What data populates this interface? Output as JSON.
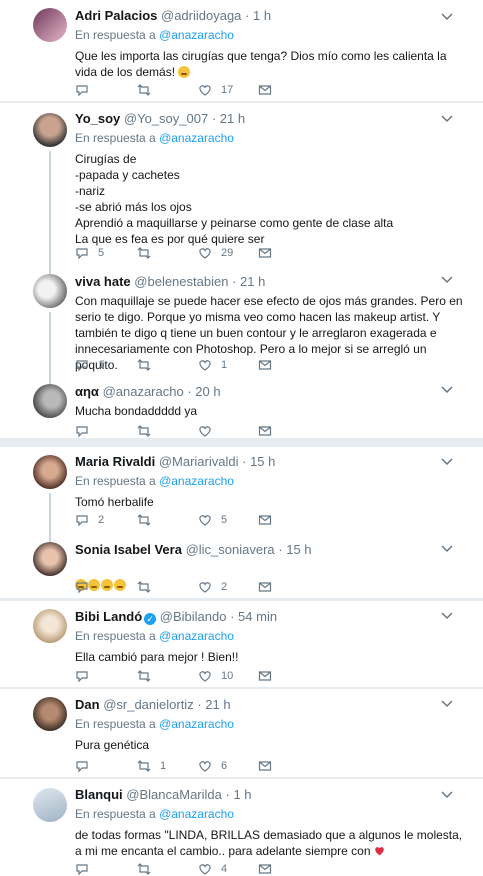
{
  "colors": {
    "accent": "#1da1f2",
    "heart": "#e0245e",
    "muted": "#657786",
    "background": "#e6ecf0"
  },
  "tweets": [
    {
      "name": "Adri Palacios",
      "handle": "@adriidoyaga",
      "time": "· 1 h",
      "reply_prefix": "En respuesta a",
      "reply_to": "@anazaracho",
      "text": "Que les importa las cirugías que tenga? Dios mío como les calienta la vida de los demás!",
      "emoji": "grinning-face-emoji",
      "replies": "",
      "retweets": "",
      "likes": "17"
    },
    {
      "name": "Yo_soy",
      "handle": "@Yo_soy_007",
      "time": "· 21 h",
      "reply_prefix": "En respuesta a",
      "reply_to": "@anazaracho",
      "text": "Cirugías de\n-papada y cachetes\n-nariz\n-se abrió más los ojos\nAprendió a maquillarse y peinarse como gente de clase alta\nLa que es fea es por qué quiere ser",
      "replies": "5",
      "retweets": "",
      "likes": "29"
    },
    {
      "name": "viva hate",
      "handle": "@belenestabien",
      "time": "· 21 h",
      "text": "Con maquillaje se puede hacer ese efecto de ojos más grandes. Pero en serio te digo. Porque yo misma veo como hacen las makeup artist. Y también te digo q tiene un buen contour y le arreglaron exagerada e innecesariamente con Photoshop. Pero a lo mejor si se arregló un poquito.",
      "replies": "1",
      "retweets": "",
      "likes": "1"
    },
    {
      "name": "αηα",
      "handle": "@anazaracho",
      "time": "· 20 h",
      "text": "Mucha bondaddddd ya",
      "replies": "",
      "retweets": "",
      "likes": ""
    },
    {
      "name": "Maria Rivaldi",
      "handle": "@Mariarivaldi",
      "time": "· 15 h",
      "reply_prefix": "En respuesta a",
      "reply_to": "@anazaracho",
      "text": "Tomó herbalife",
      "replies": "2",
      "retweets": "",
      "likes": "5"
    },
    {
      "name": "Sonia Isabel Vera",
      "handle": "@lic_soniavera",
      "time": "· 15 h",
      "text": "",
      "emoji_count": 4,
      "emoji": "tears-of-joy-emoji",
      "replies": "",
      "retweets": "",
      "likes": "2"
    },
    {
      "name": "Bibi Landó",
      "handle": "@Bibilando",
      "time": "· 54 min",
      "verified": true,
      "reply_prefix": "En respuesta a",
      "reply_to": "@anazaracho",
      "text": "Ella cambió para mejor ! Bien!!",
      "replies": "",
      "retweets": "",
      "likes": "10"
    },
    {
      "name": "Dan",
      "handle": "@sr_danielortiz",
      "time": "· 21 h",
      "reply_prefix": "En respuesta a",
      "reply_to": "@anazaracho",
      "text": "Pura genética",
      "replies": "",
      "retweets": "1",
      "likes": "6"
    },
    {
      "name": "Blanqui",
      "handle": "@BlancaMarilda",
      "time": "· 1 h",
      "reply_prefix": "En respuesta a",
      "reply_to": "@anazaracho",
      "text": "de todas formas \"LINDA, BRILLAS demasiado que a algunos le molesta, a mi me encanta el cambio.. para adelante siempre con",
      "emoji": "red-heart-emoji",
      "replies": "",
      "retweets": "",
      "likes": "4"
    }
  ]
}
